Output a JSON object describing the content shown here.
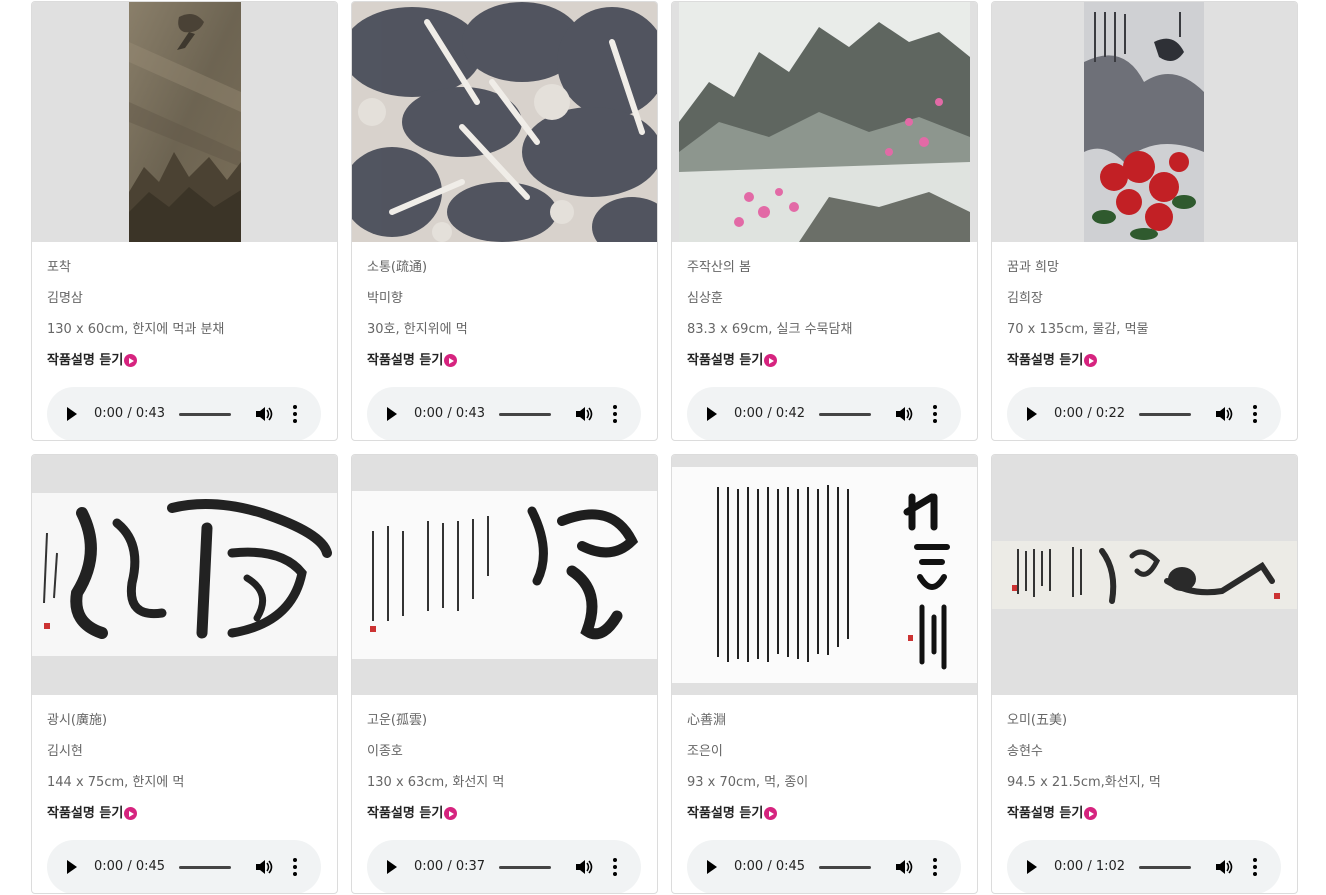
{
  "listen_label": "작품설명 듣기",
  "cards": [
    {
      "title": "포착",
      "artist": "김명삼",
      "spec": "130 x 60cm, 한지에 먹과 분채",
      "time": "0:00 / 0:43"
    },
    {
      "title": "소통(疏通)",
      "artist": "박미향",
      "spec": "30호, 한지위에 먹",
      "time": "0:00 / 0:43"
    },
    {
      "title": "주작산의 봄",
      "artist": "심상훈",
      "spec": "83.3 x 69cm, 실크 수묵담채",
      "time": "0:00 / 0:42"
    },
    {
      "title": "꿈과 희망",
      "artist": "김희장",
      "spec": "70 x 135cm, 물감, 먹물",
      "time": "0:00 / 0:22"
    },
    {
      "title": "광시(廣施)",
      "artist": "김시현",
      "spec": "144 x 75cm, 한지에 먹",
      "time": "0:00 / 0:45"
    },
    {
      "title": "고운(孤雲)",
      "artist": "이종호",
      "spec": "130 x 63cm, 화선지 먹",
      "time": "0:00 / 0:37"
    },
    {
      "title": "心善淵",
      "artist": "조은이",
      "spec": "93 x 70cm, 먹, 종이",
      "time": "0:00 / 0:45"
    },
    {
      "title": "오미(五美)",
      "artist": "송현수",
      "spec": "94.5 x 21.5cm,화선지, 먹",
      "time": "0:00 / 1:02"
    }
  ],
  "colors": {
    "accent": "#d6247f",
    "player_bg": "#f1f3f4",
    "thumb_bg": "#e0e0e0"
  }
}
